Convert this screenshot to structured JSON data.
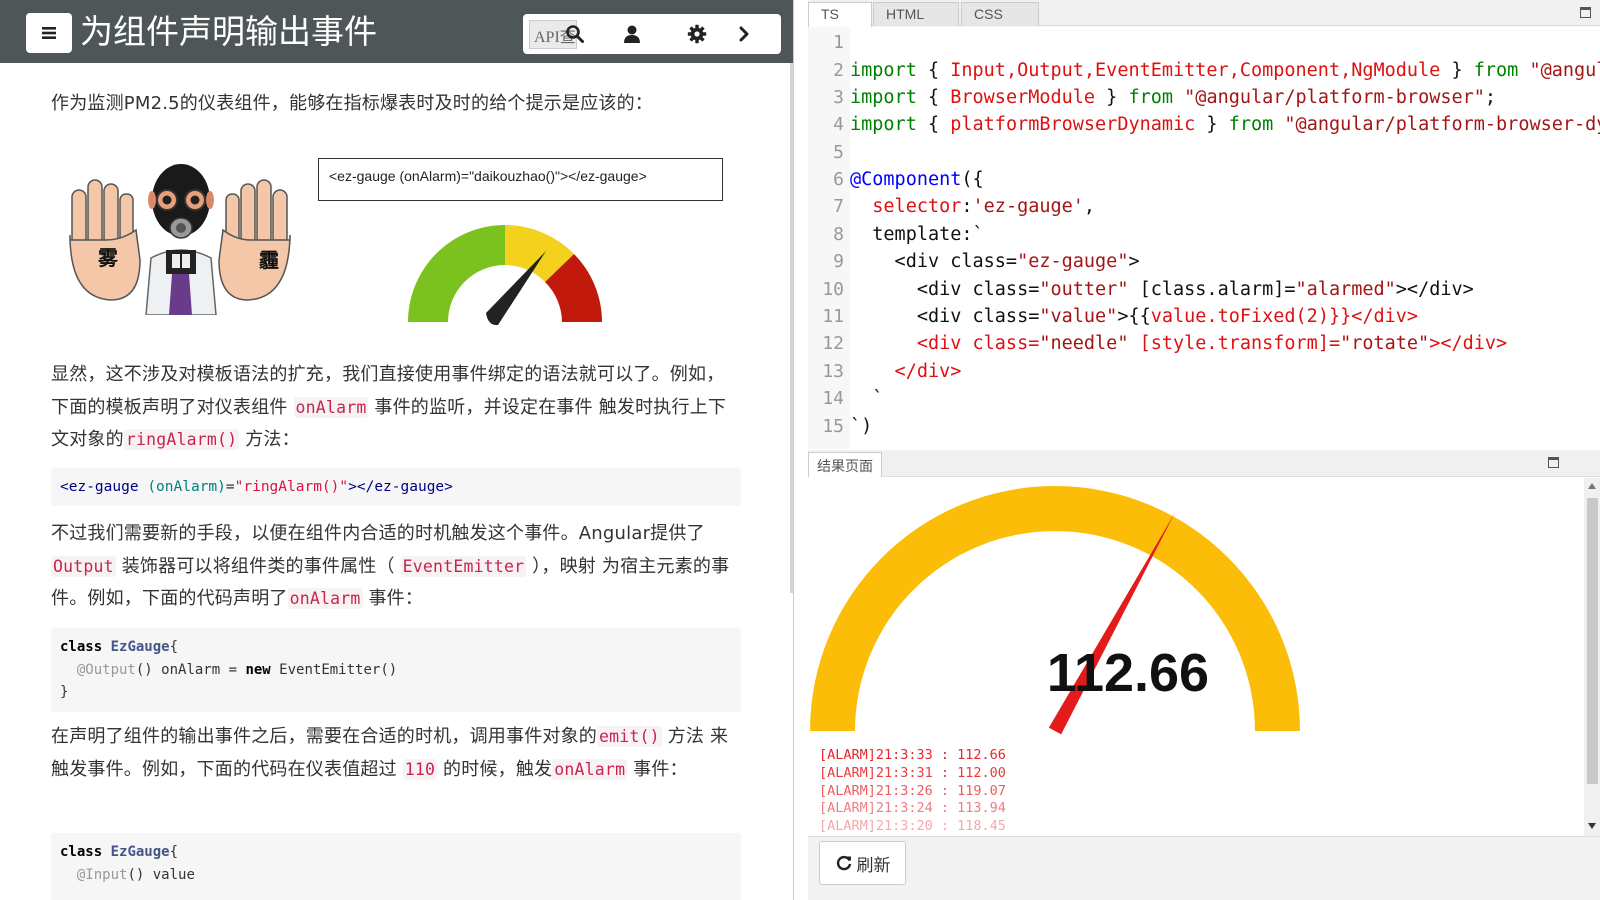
{
  "header": {
    "title": "为组件声明输出事件",
    "search_placeholder": "API查询"
  },
  "article": {
    "intro": "作为监测PM2.5的仪表组件，能够在指标爆表时及时的给个提示是应该的：",
    "figure": {
      "alarm_tag": "<ez-gauge (onAlarm)=\"daikouzhao()\"></ez-gauge>",
      "hand_left_text": "雾",
      "hand_right_text": "霾"
    },
    "p2": {
      "a": "显然，这不涉及对模板语法的扩充，我们直接使用事件绑定的语法就可以了。例如，下面的模板声明了对仪表组件 ",
      "code1": "onAlarm",
      "b": " 事件的监听，并设定在事件 触发时执行上下文对象的",
      "code2": "ringAlarm()",
      "c": " 方法："
    },
    "code_block_1": {
      "tag_open": "<ez-gauge ",
      "attr": "(onAlarm)",
      "eq": "=",
      "val": "\"ringAlarm()\"",
      "tag_close": "></ez-gauge>"
    },
    "p3": {
      "a": "不过我们需要新的手段，以便在组件内合适的时机触发这个事件。Angular提供了 ",
      "code1": "Output",
      "b": " 装饰器可以将组件类的事件属性（ ",
      "code2": "EventEmitter",
      "c": " ），映射 为宿主元素的事件。例如，下面的代码声明了",
      "code3": "onAlarm",
      "d": " 事件："
    },
    "code_block_2": {
      "line1_kw": "class",
      "line1_name": "EzGauge",
      "line1_tail": "{",
      "line2_dec": "@Output",
      "line2_tail": "() onAlarm = ",
      "line2_kw": "new",
      "line2_end": " EventEmitter()",
      "line3": "}"
    },
    "p4": {
      "a": "在声明了组件的输出事件之后，需要在合适的时机，调用事件对象的",
      "code1": "emit()",
      "b": " 方法 来触发事件。例如，下面的代码在仪表值超过 ",
      "code2": "110",
      "c": " 的时候，触发",
      "code3": "onAlarm",
      "d": " 事件："
    },
    "code_block_3": {
      "line1_kw": "class",
      "line1_name": "EzGauge",
      "line1_tail": "{",
      "line2_dec": "@Input",
      "line2_tail": "() value"
    }
  },
  "editor": {
    "tabs": [
      "TS",
      "HTML",
      "CSS"
    ],
    "active_tab": "TS",
    "lines": [
      {
        "n": "1"
      },
      {
        "n": "2"
      },
      {
        "n": "3"
      },
      {
        "n": "4"
      },
      {
        "n": "5"
      },
      {
        "n": "6"
      },
      {
        "n": "7"
      },
      {
        "n": "8"
      },
      {
        "n": "9"
      },
      {
        "n": "10"
      },
      {
        "n": "11"
      },
      {
        "n": "12"
      },
      {
        "n": "13"
      },
      {
        "n": "14"
      },
      {
        "n": "15"
      }
    ],
    "code": {
      "l2": {
        "kw": "import",
        "b1": " { ",
        "types": "Input,Output,EventEmitter,Component,NgModule",
        "b2": " } ",
        "from": "from",
        "str": " \"@angul"
      },
      "l3": {
        "kw": "import",
        "b1": " { ",
        "types": "BrowserModule",
        "b2": " } ",
        "from": "from",
        "str": " \"@angular/platform-browser\"",
        "end": ";"
      },
      "l4": {
        "kw": "import",
        "b1": " { ",
        "types": "platformBrowserDynamic",
        "b2": " } ",
        "from": "from",
        "str": " \"@angular/platform-browser-dy"
      },
      "l6": {
        "dec": "@Component",
        "rest": "({"
      },
      "l7": {
        "key": "  selector",
        "colon": ":",
        "str": "'ez-gauge'",
        "end": ","
      },
      "l8": {
        "text": "  template:`"
      },
      "l9": {
        "a": "    <div class=",
        "s": "\"ez-gauge\"",
        "b": ">"
      },
      "l10": {
        "a": "      <div class=",
        "s1": "\"outter\"",
        "b": " [class.alarm]=",
        "s2": "\"alarmed\"",
        "c": "></div>"
      },
      "l11": {
        "a": "      <div class=",
        "s1": "\"value\"",
        "b": ">{{",
        "c": "value.toFixed",
        "d": "(2)}}</div>"
      },
      "l12": {
        "a": "      <div class=",
        "s1": "\"needle\"",
        "b": " [style.transform]=",
        "s2": "\"rotate\"",
        "c": "></div>"
      },
      "l13": {
        "a": "    </div>"
      },
      "l14": {
        "a": "  `"
      },
      "l15": {
        "a": "`)"
      }
    }
  },
  "result": {
    "tab_label": "结果页面",
    "gauge_value": "112.66",
    "gauge_level": 0.66,
    "gauge_color": "#fbbd08",
    "needle_color": "#e41b1b",
    "alarm_log": [
      "[ALARM]21:3:33 : 112.66",
      "[ALARM]21:3:31 : 112.00",
      "[ALARM]21:3:26 : 119.07",
      "[ALARM]21:3:24 : 113.94",
      "[ALARM]21:3:20 : 118.45"
    ],
    "refresh_label": "刷新"
  }
}
